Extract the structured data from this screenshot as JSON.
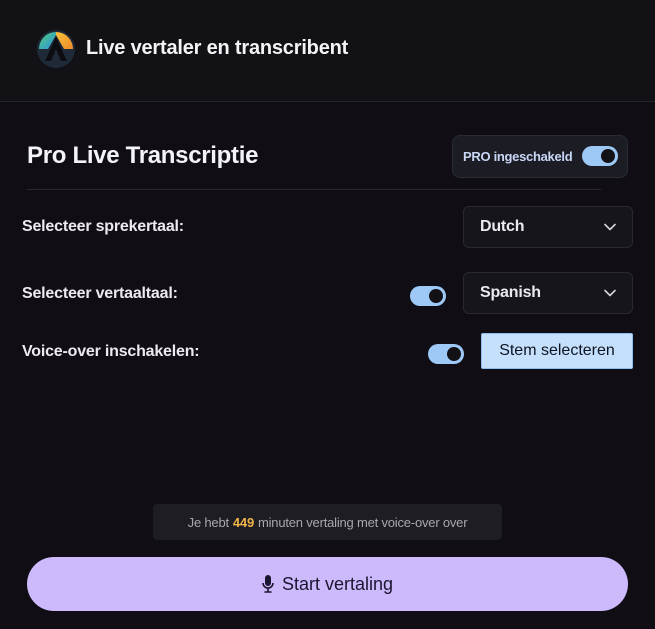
{
  "header": {
    "title": "Live vertaler en transcribent",
    "logo_icon": "app-logo-icon"
  },
  "section": {
    "title": "Pro Live Transcriptie",
    "pro_label": "PRO ingeschakeld",
    "pro_enabled": true
  },
  "speaker_language": {
    "label": "Selecteer sprekertaal:",
    "value": "Dutch"
  },
  "translation_language": {
    "label": "Selecteer vertaaltaal:",
    "value": "Spanish",
    "enabled": true
  },
  "voice_over": {
    "label": "Voice-over inschakelen:",
    "enabled": true,
    "button_label": "Stem selecteren"
  },
  "notice": {
    "prefix": "Je hebt",
    "minutes": "449",
    "suffix": "minuten vertaling met voice-over over"
  },
  "start": {
    "label": "Start vertaling",
    "icon": "microphone-icon"
  },
  "colors": {
    "background": "#100e14",
    "toggle_on": "#9ec9f6",
    "accent_button": "#cdbafc",
    "voice_button": "#c4e0fc",
    "minutes_highlight": "#f0b54a"
  }
}
